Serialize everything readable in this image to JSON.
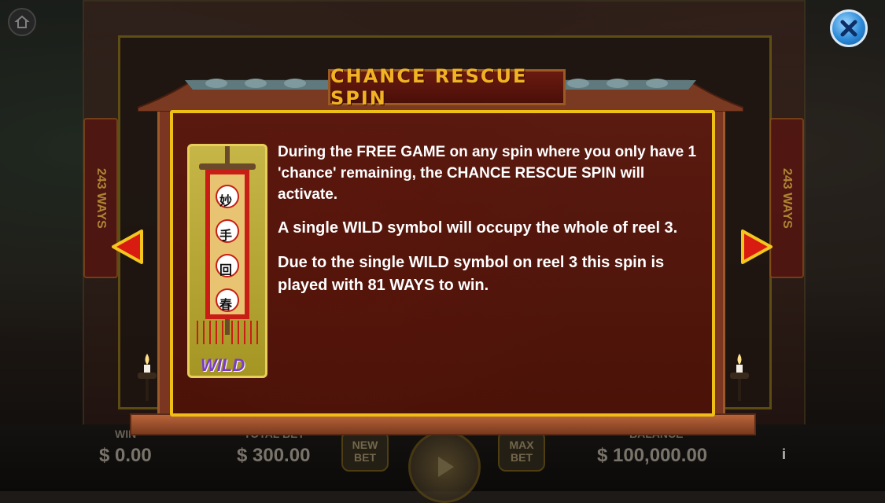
{
  "popup": {
    "title": "CHANCE RESCUE SPIN",
    "paragraphs": [
      "During the FREE GAME on any spin where you only have 1 'chance' remaining, the CHANCE RESCUE SPIN will activate.",
      "A single WILD symbol will occupy the whole of reel 3.",
      "Due to the single WILD symbol on reel 3 this spin is played with 81 WAYS to win."
    ],
    "symbol": {
      "characters": [
        "妙",
        "手",
        "回",
        "春"
      ],
      "label": "WILD"
    }
  },
  "side_banner": {
    "text": "243 WAYS"
  },
  "bottom_bar": {
    "win_label": "WIN",
    "win_value": "$ 0.00",
    "total_bet_label": "TOTAL BET",
    "total_bet_value": "$ 300.00",
    "new_bet_label": "NEW BET",
    "max_bet_label": "MAX BET",
    "balance_label": "BALANCE",
    "balance_value": "$ 100,000.00",
    "info_label": "i"
  },
  "colors": {
    "title": "#f1b323",
    "panel_border": "#f0bf16",
    "panel_bg": "#4a1208",
    "arrow_fill": "#d81c12",
    "arrow_border": "#f4c61e",
    "wild_text": "#7b3dc4"
  },
  "icons": {
    "close": "close-icon",
    "home": "home-icon",
    "prev": "triangle-left-icon",
    "next": "triangle-right-icon",
    "spin": "play-icon"
  }
}
